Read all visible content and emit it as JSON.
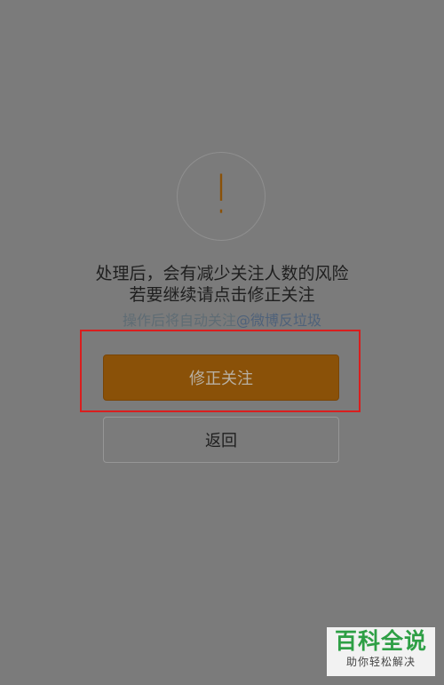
{
  "dialog": {
    "warning_line1": "处理后，会有减少关注人数的风险",
    "warning_line2": "若要继续请点击修正关注",
    "hint_prefix": "操作后将自动关注",
    "hint_mention": "@微博反垃圾"
  },
  "buttons": {
    "primary_label": "修正关注",
    "secondary_label": "返回"
  },
  "watermark": {
    "title": "百科全说",
    "subtitle": "助你轻松解决"
  },
  "colors": {
    "overlay": "#7b7b7b",
    "primary_button": "#8a5108",
    "highlight_border": "#d91e1e",
    "watermark_green": "#2e9f45"
  },
  "icons": {
    "alert": "alert-exclamation-icon"
  }
}
